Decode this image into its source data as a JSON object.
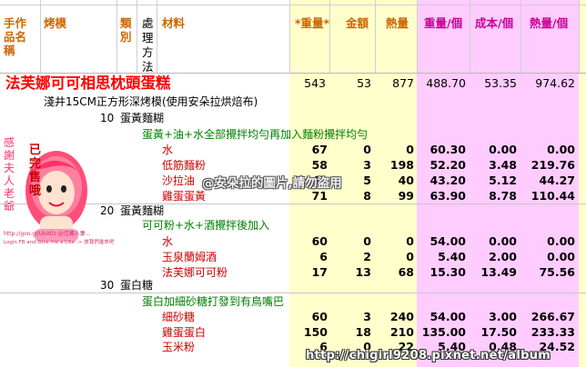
{
  "header": {
    "col_name": "手作品名稱",
    "col_mold": "烤模",
    "col_category": "類別",
    "col_method": "處理方法",
    "col_ingredient": "材料",
    "col_weight": "*重量*",
    "col_amount": "金額",
    "col_calories": "熱量",
    "col_weight_per": "重量/個",
    "col_cost_per": "成本/個",
    "col_cal_per": "熱量/個"
  },
  "recipe": {
    "title": "法芙娜可可相思枕頭蛋糕",
    "weight": "543",
    "amount": "53",
    "calories": "877",
    "weight_per": "488.70",
    "cost_per": "53.35",
    "cal_per": "974.62",
    "mold": "淺井15CM正方形深烤模(使用安朵拉烘焙布)"
  },
  "sections": [
    {
      "number": "10",
      "label": "蛋黃麵糊",
      "instruction": "蛋黃+油+水全部攪拌均勻再加入麵粉攪拌均勻",
      "items": [
        {
          "name": "水",
          "weight": "67",
          "amount": "0",
          "cal": "0",
          "wp": "60.30",
          "cp": "0.00",
          "calp": "0.00"
        },
        {
          "name": "低筋麵粉",
          "weight": "58",
          "amount": "3",
          "cal": "198",
          "wp": "52.20",
          "cp": "3.48",
          "calp": "219.76"
        },
        {
          "name": "沙拉油",
          "weight": "48",
          "amount": "5",
          "cal": "40",
          "wp": "43.20",
          "cp": "5.12",
          "calp": "44.27"
        },
        {
          "name": "雞蛋蛋黃",
          "weight": "71",
          "amount": "8",
          "cal": "99",
          "wp": "63.90",
          "cp": "8.78",
          "calp": "110.44"
        }
      ]
    },
    {
      "number": "20",
      "label": "蛋黃麵糊",
      "instruction": "可可粉+水+酒攪拌後加入",
      "items": [
        {
          "name": "水",
          "weight": "60",
          "amount": "0",
          "cal": "0",
          "wp": "54.00",
          "cp": "0.00",
          "calp": "0.00"
        },
        {
          "name": "玉泉蘭姆酒",
          "weight": "6",
          "amount": "2",
          "cal": "0",
          "wp": "5.40",
          "cp": "2.00",
          "calp": "0.00"
        },
        {
          "name": "法芙娜可可粉",
          "weight": "17",
          "amount": "13",
          "cal": "68",
          "wp": "15.30",
          "cp": "13.49",
          "calp": "75.56"
        }
      ]
    },
    {
      "number": "30",
      "label": "蛋白糖",
      "instruction": "蛋白加細砂糖打發到有鳥嘴巴",
      "items": [
        {
          "name": "細砂糖",
          "weight": "60",
          "amount": "3",
          "cal": "240",
          "wp": "54.00",
          "cp": "3.00",
          "calp": "266.67"
        },
        {
          "name": "雞蛋蛋白",
          "weight": "150",
          "amount": "18",
          "cal": "210",
          "wp": "135.00",
          "cp": "17.50",
          "calp": "233.33"
        },
        {
          "name": "玉米粉",
          "weight": "6",
          "amount": "0",
          "cal": "22",
          "wp": "5.40",
          "cp": "0.48",
          "calp": "24.52"
        }
      ]
    }
  ],
  "sticker": {
    "left_text": "感謝夫人老爺",
    "right_text": "已完售哦",
    "caption": "http://goo.gl/UkAtlz @佳藏人妻...",
    "caption2": "Login FB and Give me a Like -> 放我們進來吧"
  },
  "watermark": "@安朵拉的圖片,請勿盜用",
  "url_overlay": "http://chigirl9208.pixnet.net/album"
}
